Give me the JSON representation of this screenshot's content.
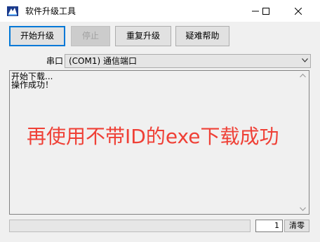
{
  "window": {
    "title": "软件升级工具",
    "controls": {
      "minimize": "minimize-icon",
      "maximize": "maximize-icon",
      "close": "close-icon"
    }
  },
  "toolbar": {
    "start_label": "开始升级",
    "stop_label": "停止",
    "repeat_label": "重复升级",
    "help_label": "疑难帮助"
  },
  "port": {
    "label": "串口",
    "selected": "(COM1) 通信端口"
  },
  "log": {
    "lines": [
      "开始下载...",
      "操作成功！"
    ]
  },
  "overlay": {
    "text": "再使用不带ID的exe下载成功",
    "color": "#ef4036"
  },
  "status": {
    "progress": 0,
    "count": "1",
    "clear_label": "清零"
  },
  "colors": {
    "primary_border": "#0078d7",
    "overlay_text": "#ef4036",
    "progress_fill": "#06b025"
  }
}
